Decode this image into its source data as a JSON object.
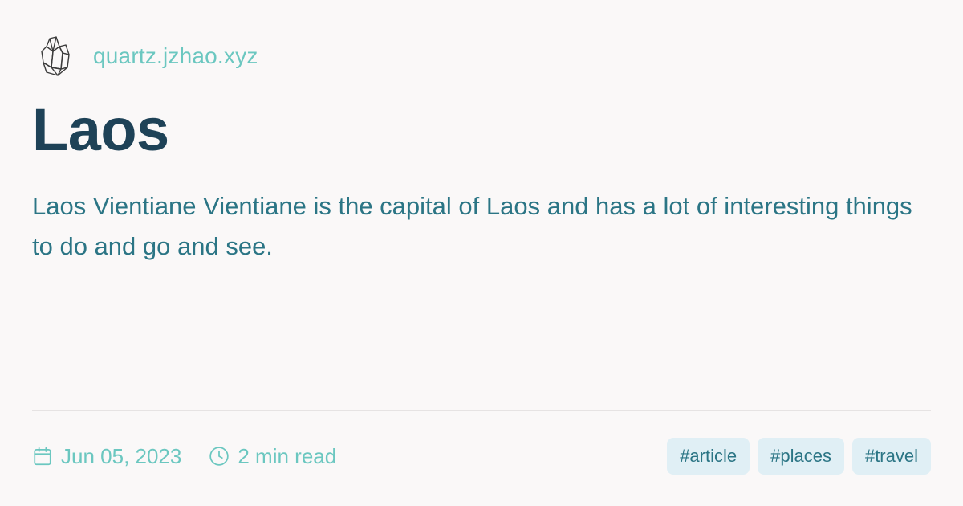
{
  "site": {
    "logo_icon": "crystal-icon",
    "domain": "quartz.jzhao.xyz"
  },
  "page": {
    "title": "Laos",
    "description": "Laos Vientiane Vientiane is the capital of Laos and has a lot of interesting things to do and go and see."
  },
  "meta": {
    "date_icon": "calendar-icon",
    "date": "Jun 05, 2023",
    "reading_time_icon": "clock-icon",
    "reading_time": "2 min read"
  },
  "tags": [
    {
      "label": "#article"
    },
    {
      "label": "#places"
    },
    {
      "label": "#travel"
    }
  ],
  "colors": {
    "background": "#faf8f8",
    "title": "#1e4257",
    "description": "#2b7585",
    "accent": "#6bc7c0",
    "tag_background": "#e0eff5"
  }
}
